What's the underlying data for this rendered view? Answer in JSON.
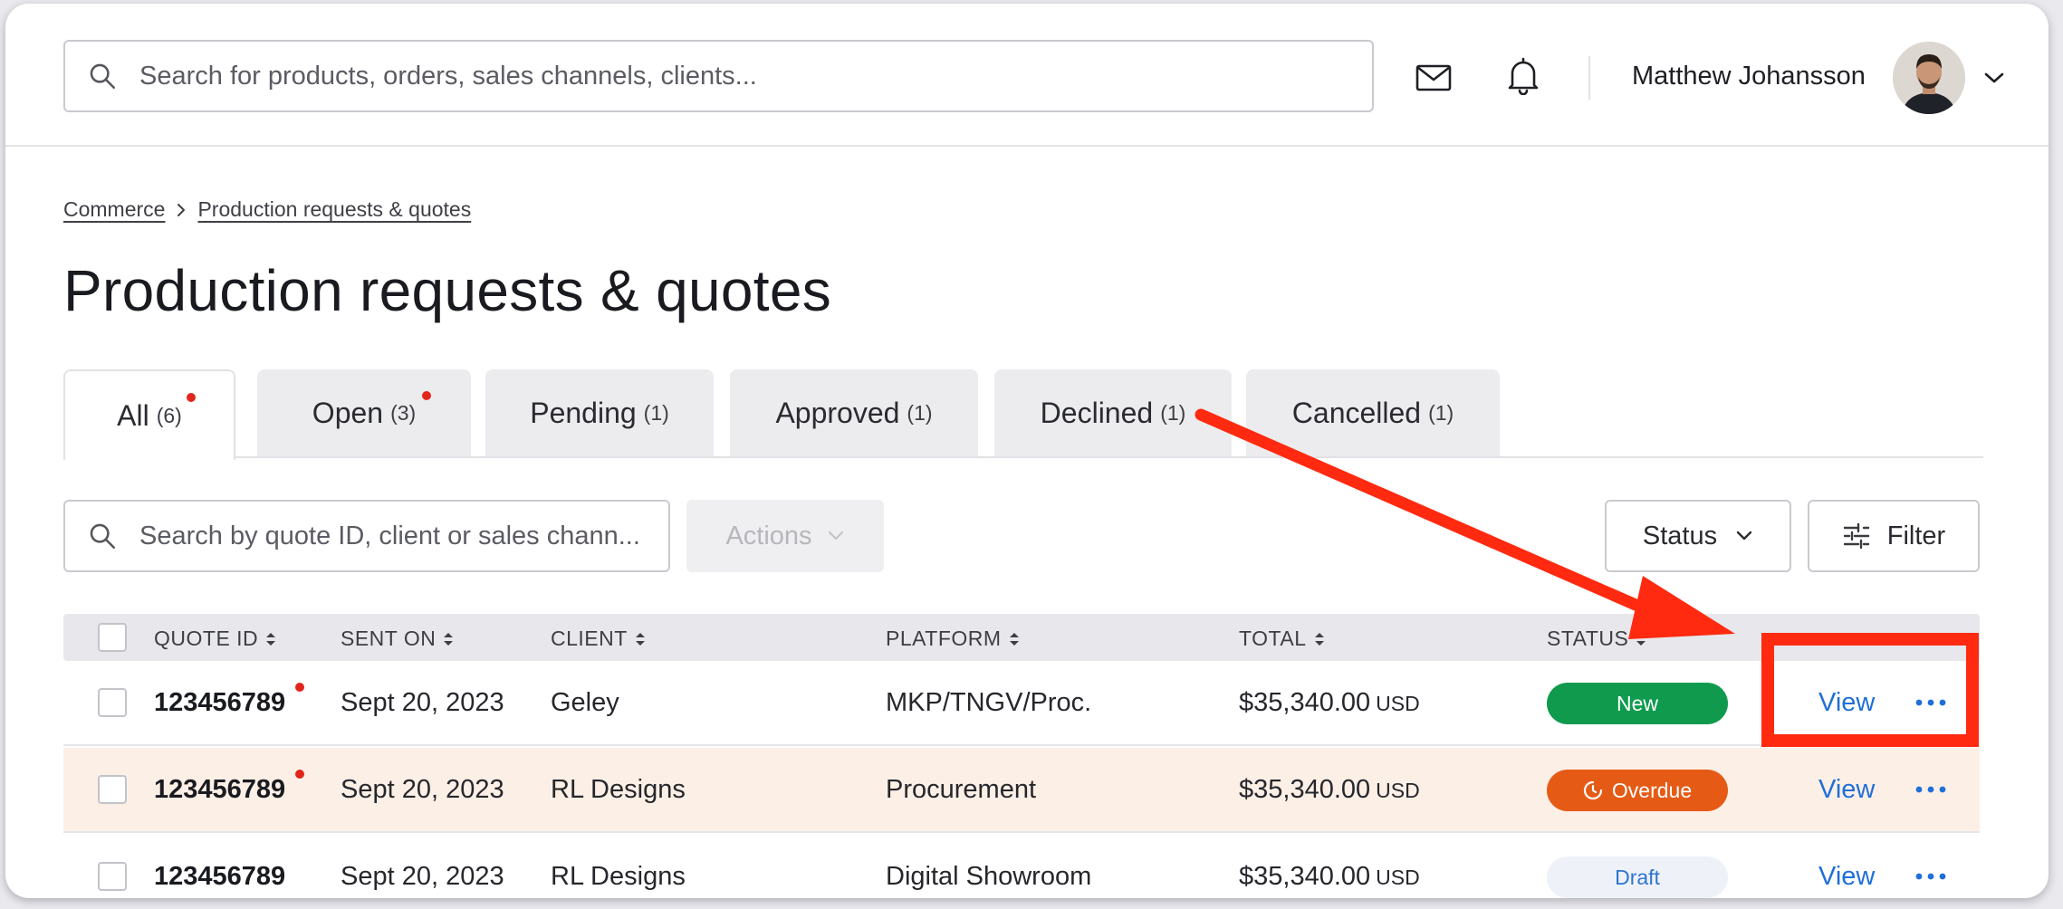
{
  "header": {
    "search_placeholder": "Search for products, orders, sales channels, clients...",
    "user_name": "Matthew Johansson"
  },
  "breadcrumb": {
    "items": [
      "Commerce",
      "Production requests & quotes"
    ]
  },
  "page": {
    "title": "Production requests & quotes"
  },
  "tabs": [
    {
      "label": "All",
      "count": "(6)",
      "active": true,
      "dot": true
    },
    {
      "label": "Open",
      "count": "(3)",
      "active": false,
      "dot": true
    },
    {
      "label": "Pending",
      "count": "(1)",
      "active": false,
      "dot": false
    },
    {
      "label": "Approved",
      "count": "(1)",
      "active": false,
      "dot": false
    },
    {
      "label": "Declined",
      "count": "(1)",
      "active": false,
      "dot": false
    },
    {
      "label": "Cancelled",
      "count": "(1)",
      "active": false,
      "dot": false
    }
  ],
  "toolbar": {
    "search_placeholder": "Search by quote ID, client or sales chann...",
    "actions_label": "Actions",
    "status_label": "Status",
    "filter_label": "Filter"
  },
  "table": {
    "columns": [
      "QUOTE ID",
      "SENT ON",
      "CLIENT",
      "PLATFORM",
      "TOTAL",
      "STATUS"
    ],
    "rows": [
      {
        "id": "123456789",
        "sent_on": "Sept 20, 2023",
        "client": "Geley",
        "platform": "MKP/TNGV/Proc.",
        "total": "$35,340.00",
        "currency": "USD",
        "status": "New",
        "view": "View",
        "unread": true
      },
      {
        "id": "123456789",
        "sent_on": "Sept 20, 2023",
        "client": "RL Designs",
        "platform": "Procurement",
        "total": "$35,340.00",
        "currency": "USD",
        "status": "Overdue",
        "view": "View",
        "unread": true
      },
      {
        "id": "123456789",
        "sent_on": "Sept 20, 2023",
        "client": "RL Designs",
        "platform": "Digital Showroom",
        "total": "$35,340.00",
        "currency": "USD",
        "status": "Draft",
        "view": "View",
        "unread": false
      }
    ]
  },
  "colors": {
    "status_new": "#0f9a4e",
    "status_overdue": "#e55b15",
    "status_draft_text": "#2f74d0",
    "link": "#1f6fd8",
    "unread_dot": "#e2261c",
    "annotation": "#ff2a10"
  },
  "icons": [
    "search-icon",
    "mail-icon",
    "bell-icon",
    "chevron-down-icon",
    "chevron-right-icon",
    "sliders-icon",
    "sort-icon",
    "clock-icon",
    "more-horizontal-icon"
  ]
}
